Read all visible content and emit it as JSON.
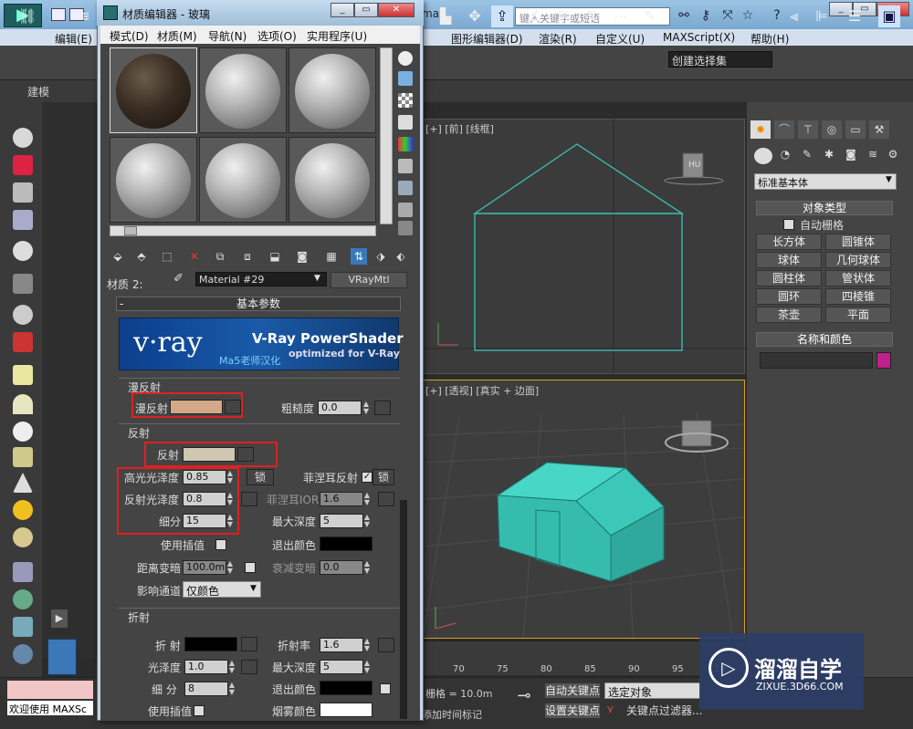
{
  "app": {
    "title_suffix": "max",
    "search_placeholder": "键入关键字或短语",
    "menu": [
      "编辑(E)",
      "图形编辑器(D)",
      "渲染(R)",
      "自定义(U)",
      "MAXScript(X)",
      "帮助(H)"
    ],
    "ribbon_tab": "建模",
    "selection_set": "创建选择集",
    "help_symbol": "?"
  },
  "command_panel": {
    "category": "标准基本体",
    "object_type_title": "对象类型",
    "auto_grid": "自动栅格",
    "primitives": [
      "长方体",
      "圆锥体",
      "球体",
      "几何球体",
      "圆柱体",
      "管状体",
      "圆环",
      "四棱锥",
      "茶壶",
      "平面"
    ],
    "name_color_title": "名称和颜色",
    "swatch_color": "#c0208a"
  },
  "viewports": {
    "top_label": "[+] [前] [线框]",
    "persp_label": "[+] [透视] [真实 + 边面]",
    "cube_label": "HU",
    "object_color": "#3bc4b4"
  },
  "timeline": {
    "ticks": [
      "70",
      "75",
      "80",
      "85",
      "90",
      "95",
      "100"
    ]
  },
  "status": {
    "listener_text": "欢迎使用 MAXSc",
    "grid": "栅格 = 10.0m",
    "add_time_tag": "添加时间标记",
    "auto_key": "自动关键点",
    "set_key": "设置关键点",
    "selected_object": "选定对象",
    "key_filters": "关键点过滤器..."
  },
  "material_editor": {
    "title": "材质编辑器 - 玻璃",
    "menu": [
      "模式(D)",
      "材质(M)",
      "导航(N)",
      "选项(O)",
      "实用程序(U)"
    ],
    "material_slot_label": "材质 2:",
    "material_name": "Material #29",
    "material_type": "VRayMtl",
    "basic_params_title": "基本参数",
    "vray_logo": "v·ray",
    "vray_banner_title": "V-Ray PowerShader",
    "vray_banner_subtitle": "optimized for V-Ray",
    "vray_banner_credit": "Ma5老师汉化",
    "diffuse_section": "漫反射",
    "diffuse_label": "漫反射",
    "diffuse_color": "#d4a888",
    "roughness_label": "粗糙度",
    "roughness_value": "0.0",
    "reflection_section": "反射",
    "reflect_label": "反射",
    "reflect_color": "#cfc7b0",
    "hilight_gloss_label": "高光光泽度",
    "hilight_gloss_value": "0.85",
    "lock_label": "锁",
    "fresnel_label": "菲涅耳反射",
    "refl_gloss_label": "反射光泽度",
    "refl_gloss_value": "0.8",
    "fresnel_ior_label": "菲涅耳IOR",
    "fresnel_ior_value": "1.6",
    "subdivs_label": "细分",
    "subdivs_value": "15",
    "max_depth_label": "最大深度",
    "max_depth_value": "5",
    "use_interp_label": "使用插值",
    "exit_color_label": "退出颜色",
    "dim_distance_label": "距离变暗",
    "dim_distance_value": "100.0m",
    "dim_falloff_label": "衰减变暗",
    "dim_falloff_value": "0.0",
    "affect_channels_label": "影响通道",
    "affect_channels_value": "仅颜色",
    "refraction_section": "折射",
    "refract_label": "折 射",
    "refract_ior_label": "折射率",
    "refract_ior_value": "1.6",
    "refr_gloss_label": "光泽度",
    "refr_gloss_value": "1.0",
    "refr_max_depth_label": "最大深度",
    "refr_max_depth_value": "5",
    "refr_subdivs_label": "细 分",
    "refr_subdivs_value": "8",
    "refr_exit_color_label": "退出颜色",
    "refr_use_interp_label": "使用插值",
    "fog_color_label": "烟雾颜色"
  },
  "watermark": {
    "title": "溜溜自学",
    "url": "ZIXUE.3D66.COM"
  }
}
